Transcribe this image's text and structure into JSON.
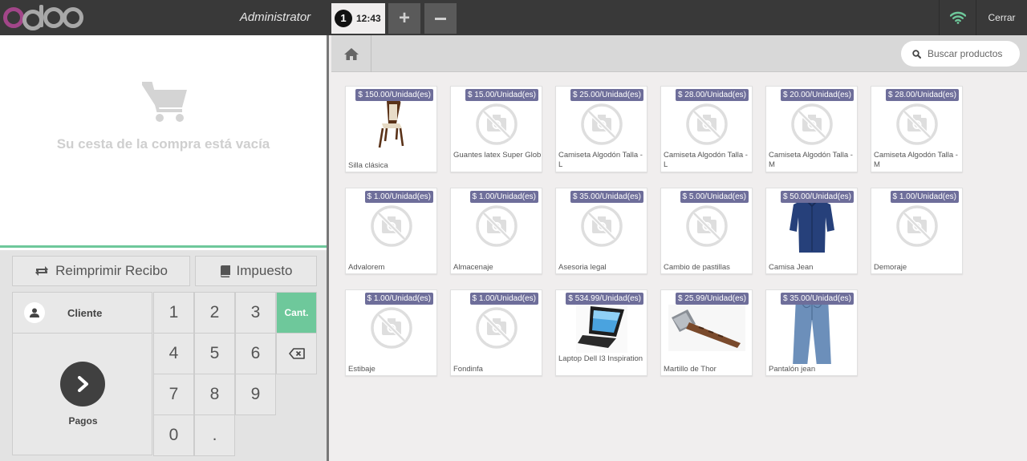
{
  "header": {
    "user": "Administrator",
    "order_number": "1",
    "order_time": "12:43",
    "add_order_label": "+",
    "close_label": "Cerrar"
  },
  "cart": {
    "empty_message": "Su cesta de la compra está vacía"
  },
  "controls": {
    "reprint_label": "Reimprimir Recibo",
    "tax_label": "Impuesto",
    "client_label": "Cliente",
    "payment_label": "Pagos"
  },
  "numpad": {
    "keys": [
      "1",
      "2",
      "3",
      "4",
      "5",
      "6",
      "7",
      "8",
      "9",
      "0",
      "."
    ],
    "mode_label": "Cant."
  },
  "search": {
    "placeholder": "Buscar productos"
  },
  "products": [
    {
      "name": "Silla clásica",
      "price": "$ 150.00/Unidad(es)",
      "image": "chair"
    },
    {
      "name": "Guantes latex Super Glob",
      "price": "$ 15.00/Unidad(es)",
      "image": "placeholder"
    },
    {
      "name": "Camiseta Algodón Talla - L",
      "price": "$ 25.00/Unidad(es)",
      "image": "placeholder"
    },
    {
      "name": "Camiseta Algodón Talla - L",
      "price": "$ 28.00/Unidad(es)",
      "image": "placeholder"
    },
    {
      "name": "Camiseta Algodón Talla - M",
      "price": "$ 20.00/Unidad(es)",
      "image": "placeholder"
    },
    {
      "name": "Camiseta Algodón Talla - M",
      "price": "$ 28.00/Unidad(es)",
      "image": "placeholder"
    },
    {
      "name": "Advalorem",
      "price": "$ 1.00/Unidad(es)",
      "image": "placeholder"
    },
    {
      "name": "Almacenaje",
      "price": "$ 1.00/Unidad(es)",
      "image": "placeholder"
    },
    {
      "name": "Asesoria legal",
      "price": "$ 35.00/Unidad(es)",
      "image": "placeholder"
    },
    {
      "name": "Cambio de pastillas",
      "price": "$ 5.00/Unidad(es)",
      "image": "placeholder"
    },
    {
      "name": "Camisa Jean",
      "price": "$ 50.00/Unidad(es)",
      "image": "shirt"
    },
    {
      "name": "Demoraje",
      "price": "$ 1.00/Unidad(es)",
      "image": "placeholder"
    },
    {
      "name": "Estibaje",
      "price": "$ 1.00/Unidad(es)",
      "image": "placeholder"
    },
    {
      "name": "Fondinfa",
      "price": "$ 1.00/Unidad(es)",
      "image": "placeholder"
    },
    {
      "name": "Laptop Dell I3 Inspiration",
      "price": "$ 534.99/Unidad(es)",
      "image": "laptop"
    },
    {
      "name": "Martillo de Thor",
      "price": "$ 25.99/Unidad(es)",
      "image": "hammer"
    },
    {
      "name": "Pantalón jean",
      "price": "$ 35.00/Unidad(es)",
      "image": "jeans"
    }
  ],
  "colors": {
    "topbar": "#393939",
    "logo_accent": "#a24689",
    "price_tag": "#6e6e9a",
    "active_green": "#6ec89b",
    "wifi": "#6ec89b"
  },
  "icons": {
    "logo": "odoo-logo",
    "cart": "shopping-cart-icon",
    "reprint": "refresh-icon",
    "tax": "book-icon",
    "client": "user-icon",
    "payment": "chevron-right-icon",
    "backspace": "backspace-icon",
    "home": "home-icon",
    "search": "search-icon",
    "wifi": "wifi-icon",
    "product_placeholder": "camera-placeholder-icon"
  }
}
